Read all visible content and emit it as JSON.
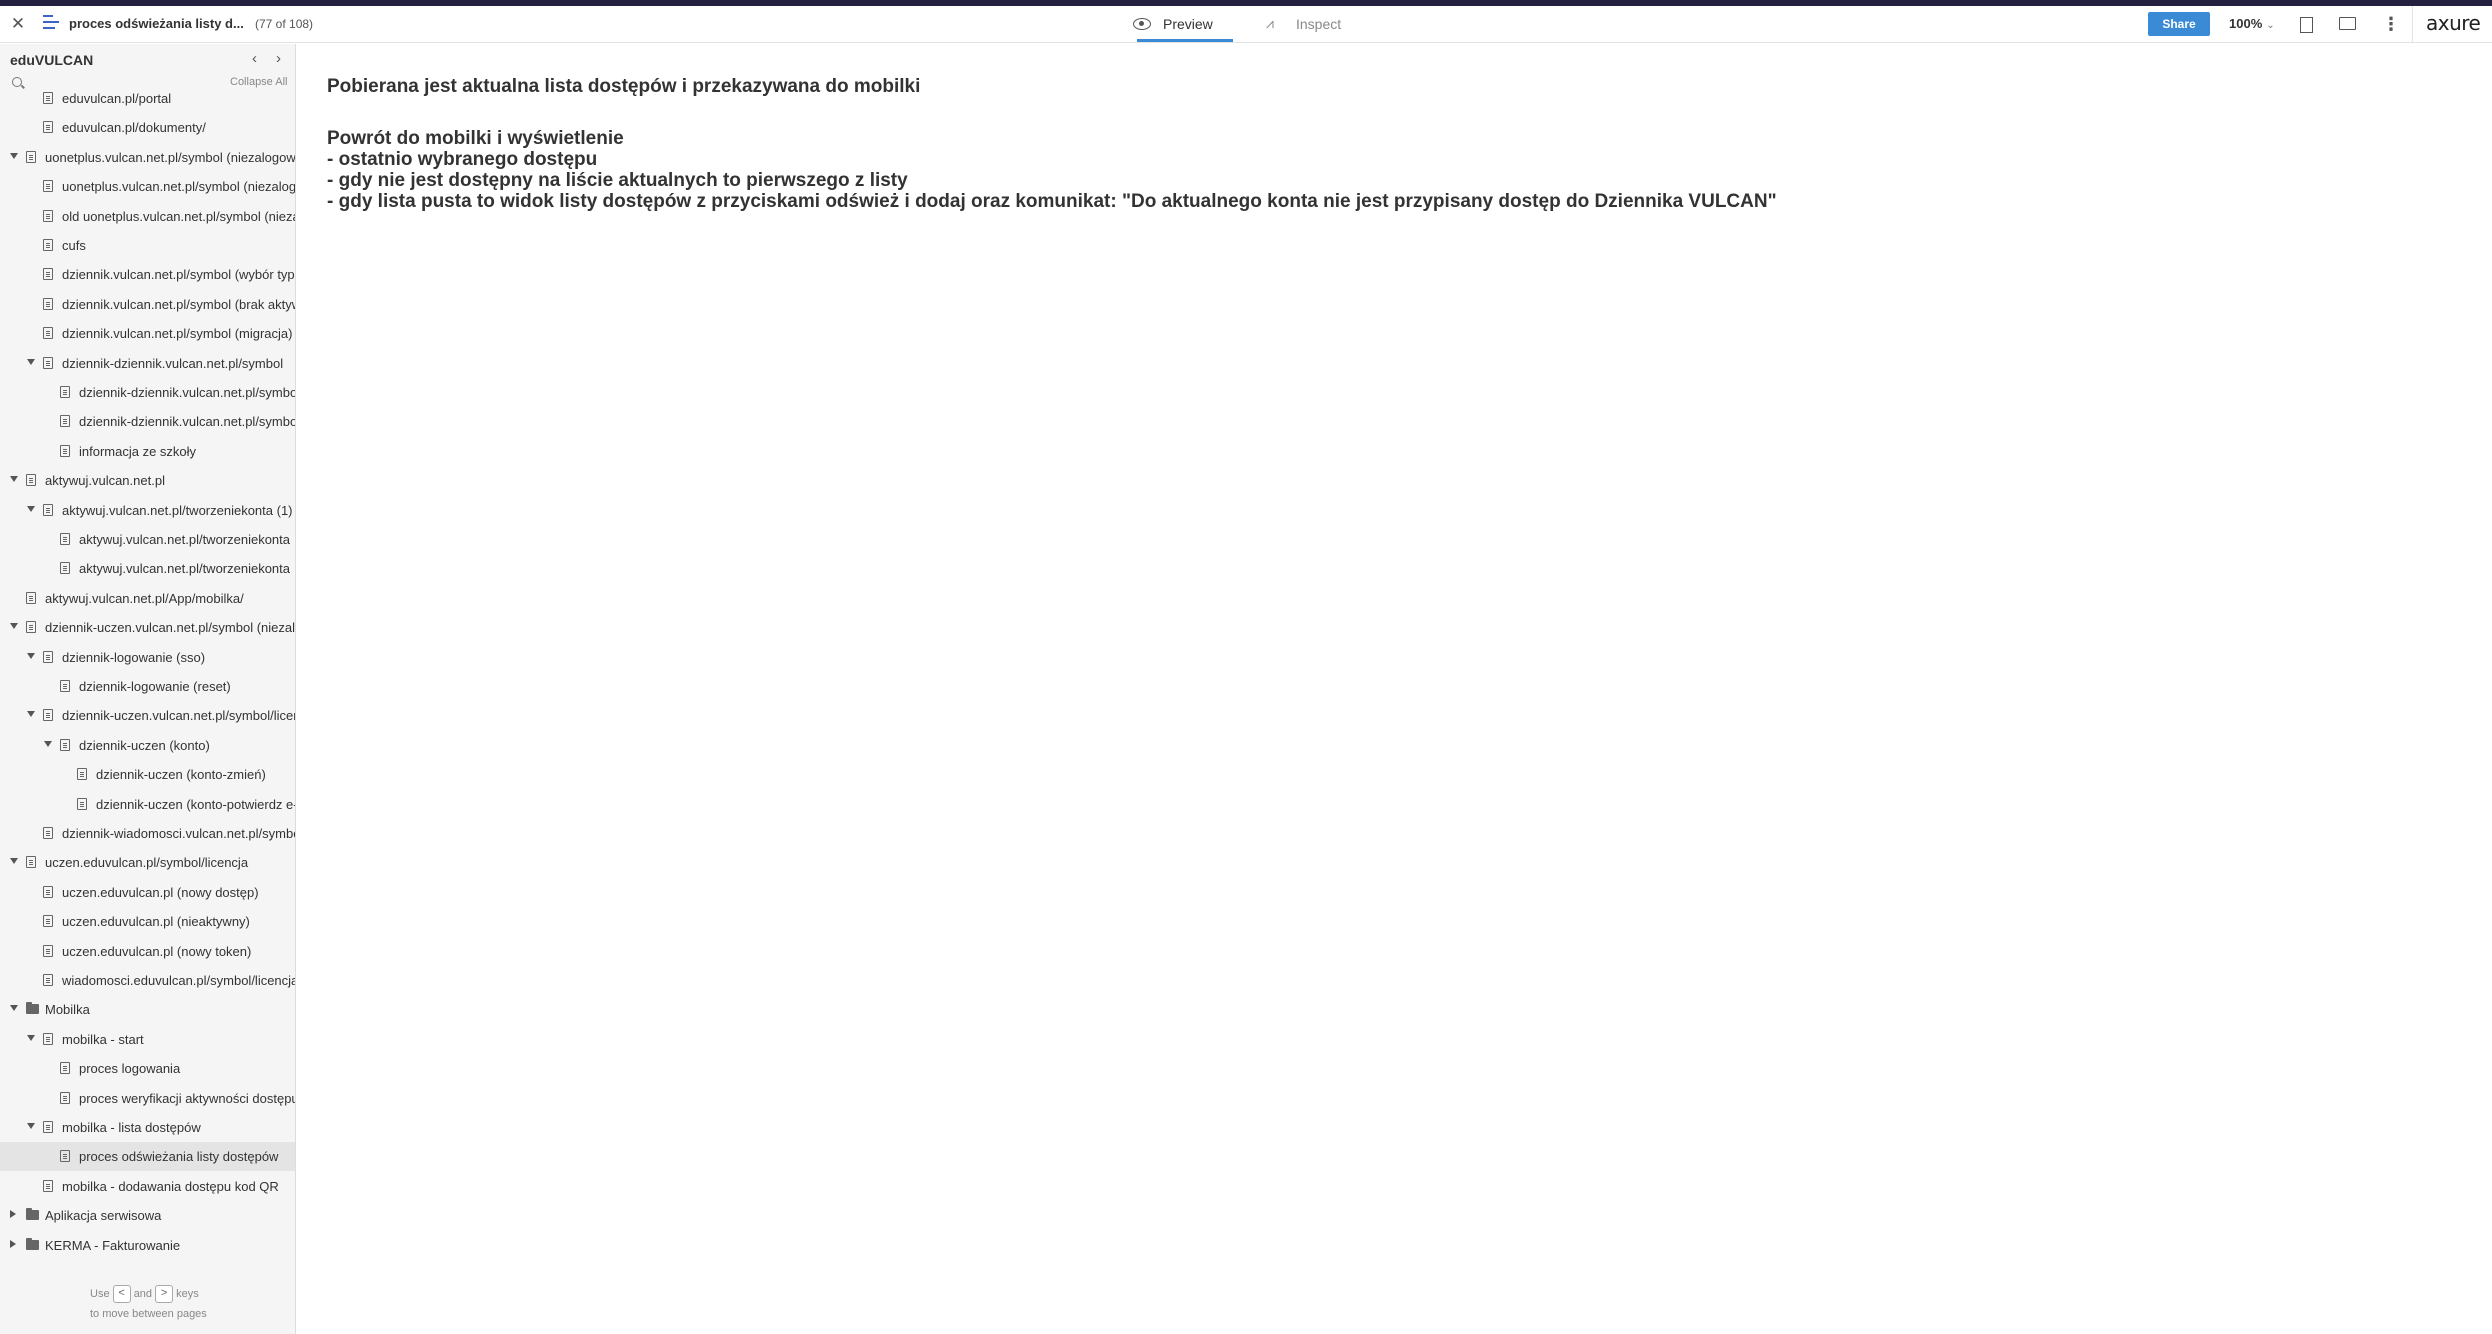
{
  "header": {
    "close_icon": "close-icon",
    "menu_icon": "hamburger-icon",
    "page_title": "proces odświeżania listy d...",
    "page_count": "(77 of 108)",
    "tabs": [
      {
        "label": "Preview",
        "icon": "eye-icon",
        "active": true
      },
      {
        "label": "Inspect",
        "icon": "inspect-icon",
        "active": false
      }
    ],
    "share_label": "Share",
    "zoom_label": "100%",
    "logo": "axure",
    "accent_color": "#3a8ad6"
  },
  "sidebar": {
    "title": "eduVULCAN",
    "collapse_all": "Collapse All",
    "hint": {
      "use": "Use",
      "and": "and",
      "keys": "keys",
      "line2": "to move between pages",
      "prev_key": "<",
      "next_key": ">"
    },
    "items": [
      {
        "label": "eduvulcan.pl/portal",
        "type": "page",
        "level": 1,
        "toggle": "none"
      },
      {
        "label": "eduvulcan.pl/dokumenty/",
        "type": "page",
        "level": 1,
        "toggle": "none"
      },
      {
        "label": "uonetplus.vulcan.net.pl/symbol (niezalogowany)",
        "type": "page",
        "level": 0,
        "toggle": "open"
      },
      {
        "label": "uonetplus.vulcan.net.pl/symbol (niezalogowany)",
        "type": "page",
        "level": 1,
        "toggle": "none"
      },
      {
        "label": "old uonetplus.vulcan.net.pl/symbol (niezalogowany)",
        "type": "page",
        "level": 1,
        "toggle": "none"
      },
      {
        "label": "cufs",
        "type": "page",
        "level": 1,
        "toggle": "none"
      },
      {
        "label": "dziennik.vulcan.net.pl/symbol (wybór typu)",
        "type": "page",
        "level": 1,
        "toggle": "none"
      },
      {
        "label": "dziennik.vulcan.net.pl/symbol (brak aktywnych)",
        "type": "page",
        "level": 1,
        "toggle": "none"
      },
      {
        "label": "dziennik.vulcan.net.pl/symbol (migracja)",
        "type": "page",
        "level": 1,
        "toggle": "none"
      },
      {
        "label": "dziennik-dziennik.vulcan.net.pl/symbol",
        "type": "page",
        "level": 1,
        "toggle": "open"
      },
      {
        "label": "dziennik-dziennik.vulcan.net.pl/symbol",
        "type": "page",
        "level": 2,
        "toggle": "none"
      },
      {
        "label": "dziennik-dziennik.vulcan.net.pl/symbol",
        "type": "page",
        "level": 2,
        "toggle": "none"
      },
      {
        "label": "informacja ze szkoły",
        "type": "page",
        "level": 2,
        "toggle": "none"
      },
      {
        "label": "aktywuj.vulcan.net.pl",
        "type": "page",
        "level": 0,
        "toggle": "open"
      },
      {
        "label": "aktywuj.vulcan.net.pl/tworzeniekonta (1)",
        "type": "page",
        "level": 1,
        "toggle": "open"
      },
      {
        "label": "aktywuj.vulcan.net.pl/tworzeniekonta",
        "type": "page",
        "level": 2,
        "toggle": "none"
      },
      {
        "label": "aktywuj.vulcan.net.pl/tworzeniekonta",
        "type": "page",
        "level": 2,
        "toggle": "none"
      },
      {
        "label": "aktywuj.vulcan.net.pl/App/mobilka/",
        "type": "page",
        "level": 0,
        "toggle": "none"
      },
      {
        "label": "dziennik-uczen.vulcan.net.pl/symbol (niezalogowany)",
        "type": "page",
        "level": 0,
        "toggle": "open"
      },
      {
        "label": "dziennik-logowanie (sso)",
        "type": "page",
        "level": 1,
        "toggle": "open"
      },
      {
        "label": "dziennik-logowanie (reset)",
        "type": "page",
        "level": 2,
        "toggle": "none"
      },
      {
        "label": "dziennik-uczen.vulcan.net.pl/symbol/licencja",
        "type": "page",
        "level": 1,
        "toggle": "open"
      },
      {
        "label": "dziennik-uczen (konto)",
        "type": "page",
        "level": 2,
        "toggle": "open"
      },
      {
        "label": "dziennik-uczen (konto-zmień)",
        "type": "page",
        "level": 3,
        "toggle": "none"
      },
      {
        "label": "dziennik-uczen (konto-potwierdz e-mail)",
        "type": "page",
        "level": 3,
        "toggle": "none"
      },
      {
        "label": "dziennik-wiadomosci.vulcan.net.pl/symbol",
        "type": "page",
        "level": 1,
        "toggle": "none"
      },
      {
        "label": "uczen.eduvulcan.pl/symbol/licencja",
        "type": "page",
        "level": 0,
        "toggle": "open"
      },
      {
        "label": "uczen.eduvulcan.pl (nowy dostęp)",
        "type": "page",
        "level": 1,
        "toggle": "none"
      },
      {
        "label": "uczen.eduvulcan.pl (nieaktywny)",
        "type": "page",
        "level": 1,
        "toggle": "none"
      },
      {
        "label": "uczen.eduvulcan.pl (nowy token)",
        "type": "page",
        "level": 1,
        "toggle": "none"
      },
      {
        "label": "wiadomosci.eduvulcan.pl/symbol/licencja",
        "type": "page",
        "level": 1,
        "toggle": "none"
      },
      {
        "label": "Mobilka",
        "type": "folder",
        "level": 0,
        "toggle": "open"
      },
      {
        "label": "mobilka - start",
        "type": "page",
        "level": 1,
        "toggle": "open"
      },
      {
        "label": "proces logowania",
        "type": "page",
        "level": 2,
        "toggle": "none"
      },
      {
        "label": "proces weryfikacji aktywności dostępu",
        "type": "page",
        "level": 2,
        "toggle": "none"
      },
      {
        "label": "mobilka - lista dostępów",
        "type": "page",
        "level": 1,
        "toggle": "open"
      },
      {
        "label": "proces odświeżania listy dostępów",
        "type": "page",
        "level": 2,
        "toggle": "none",
        "selected": true
      },
      {
        "label": "mobilka - dodawania dostępu kod QR",
        "type": "page",
        "level": 1,
        "toggle": "none"
      },
      {
        "label": "Aplikacja serwisowa",
        "type": "folder",
        "level": 0,
        "toggle": "closed"
      },
      {
        "label": "KERMA - Fakturowanie",
        "type": "folder",
        "level": 0,
        "toggle": "closed"
      }
    ]
  },
  "content": {
    "paragraphs": [
      "Pobierana jest aktualna lista dostępów i przekazywana do mobilki",
      "Powrót do mobilki i wyświetlenie",
      "- ostatnio wybranego dostępu",
      "- gdy nie jest dostępny na liście aktualnych to pierwszego z listy",
      "- gdy lista pusta to widok listy dostępów z przyciskami odśwież i dodaj oraz komunikat: \"Do aktualnego konta nie jest przypisany dostęp do Dziennika VULCAN\""
    ]
  }
}
